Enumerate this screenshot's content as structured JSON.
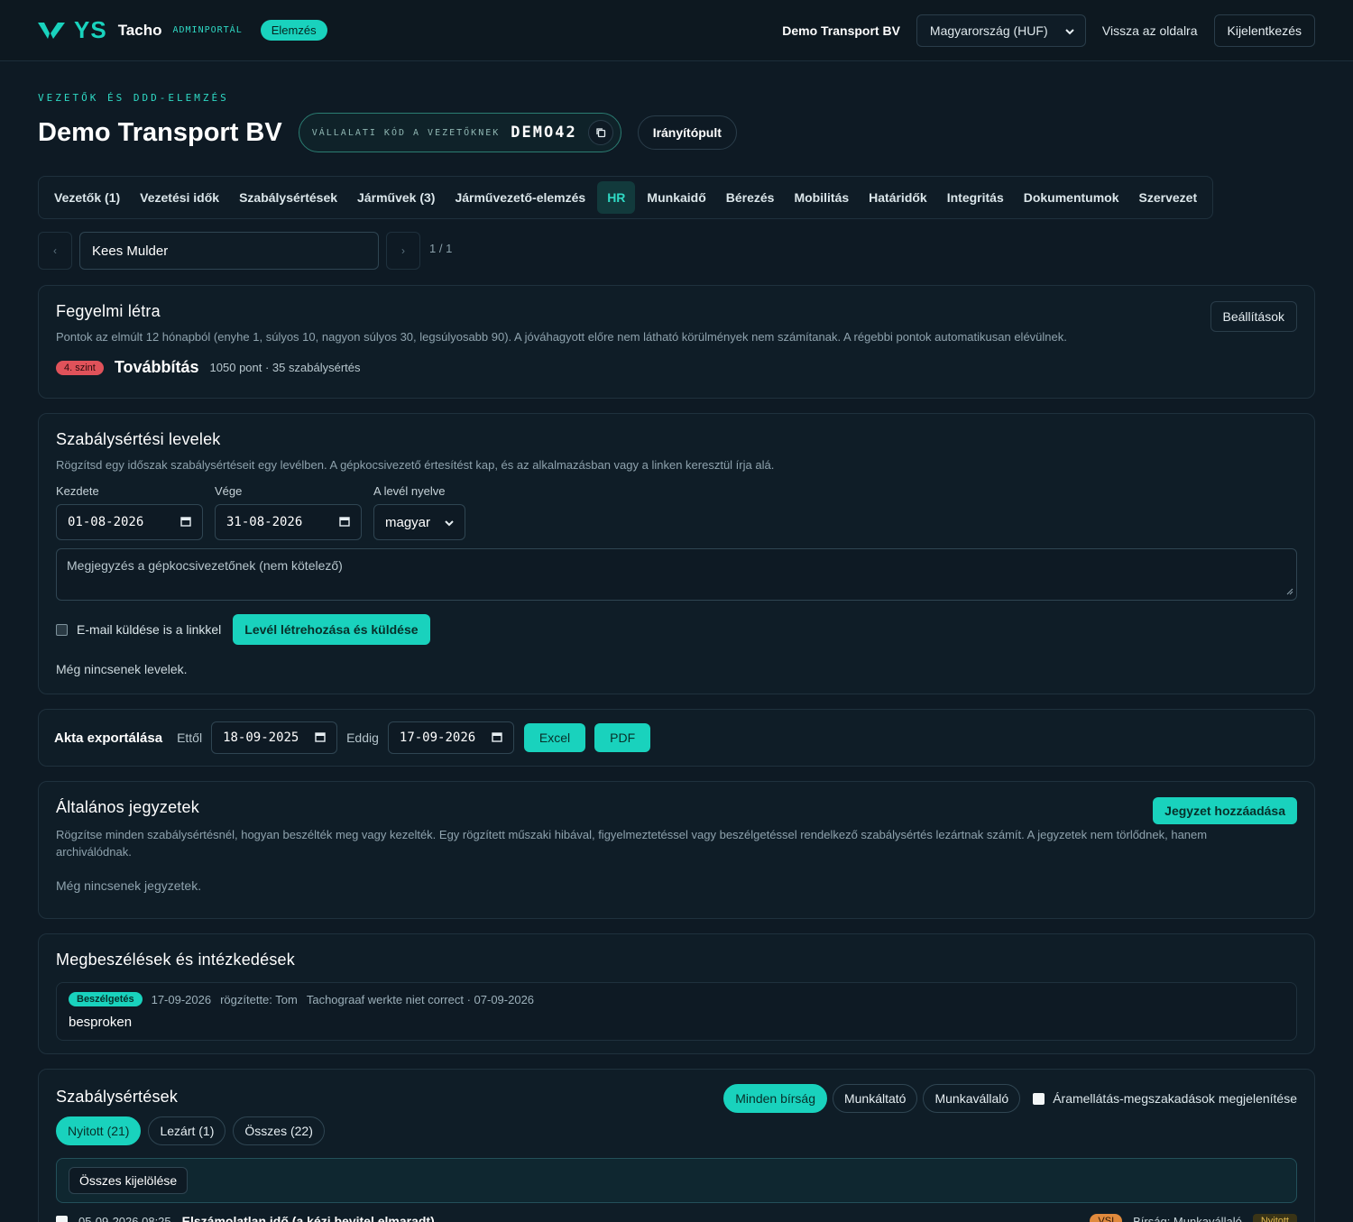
{
  "header": {
    "logo_text": "YS",
    "brand": "Tacho",
    "portal": "ADMINPORTÁL",
    "mode_badge": "Elemzés",
    "company": "Demo Transport BV",
    "country_select": "Magyarország (HUF)",
    "back_link": "Vissza az oldalra",
    "logout": "Kijelentkezés"
  },
  "page": {
    "eyebrow": "VEZETŐK ÉS DDD-ELEMZÉS",
    "title": "Demo Transport BV",
    "code_label": "VÁLLALATI KÓD A VEZETŐKNEK",
    "code_value": "DEMO42",
    "dashboard_button": "Irányítópult"
  },
  "tabs": [
    {
      "label": "Vezetők (1)"
    },
    {
      "label": "Vezetési idők"
    },
    {
      "label": "Szabálysértések"
    },
    {
      "label": "Járművek (3)"
    },
    {
      "label": "Járművezető-elemzés"
    },
    {
      "label": "HR"
    },
    {
      "label": "Munkaidő"
    },
    {
      "label": "Bérezés"
    },
    {
      "label": "Mobilitás"
    },
    {
      "label": "Határidők"
    },
    {
      "label": "Integritás"
    },
    {
      "label": "Dokumentumok"
    },
    {
      "label": "Szervezet"
    }
  ],
  "driver": {
    "prev": "‹",
    "next": "›",
    "name": "Kees Mulder",
    "pager": "1 / 1"
  },
  "ladder": {
    "title": "Fegyelmi létra",
    "settings_button": "Beállítások",
    "description": "Pontok az elmúlt 12 hónapból (enyhe 1, súlyos 10, nagyon súlyos 30, legsúlyosabb 90). A jóváhagyott előre nem látható körülmények nem számítanak. A régebbi pontok automatikusan elévülnek.",
    "level_badge": "4. szint",
    "level_name": "Továbbítás",
    "level_meta": "1050 pont · 35 szabálysértés"
  },
  "letters": {
    "title": "Szabálysértési levelek",
    "description": "Rögzítsd egy időszak szabálysértéseit egy levélben. A gépkocsivezető értesítést kap, és az alkalmazásban vagy a linken keresztül írja alá.",
    "start_label": "Kezdete",
    "start_value": "01-08-2026",
    "end_label": "Vége",
    "end_value": "31-08-2026",
    "lang_label": "A levél nyelve",
    "lang_value": "magyar",
    "note_placeholder": "Megjegyzés a gépkocsivezetőnek (nem kötelező)",
    "email_checkbox": "E-mail küldése is a linkkel",
    "create_button": "Levél létrehozása és küldése",
    "empty": "Még nincsenek levelek."
  },
  "export": {
    "title": "Akta exportálása",
    "from_label": "Ettől",
    "from_value": "18-09-2025",
    "to_label": "Eddig",
    "to_value": "17-09-2026",
    "excel": "Excel",
    "pdf": "PDF"
  },
  "notes": {
    "title": "Általános jegyzetek",
    "add_button": "Jegyzet hozzáadása",
    "description": "Rögzítse minden szabálysértésnél, hogyan beszélték meg vagy kezelték. Egy rögzített műszaki hibával, figyelmeztetéssel vagy beszélgetéssel rendelkező szabálysértés lezártnak számít. A jegyzetek nem törlődnek, hanem archiválódnak.",
    "empty": "Még nincsenek jegyzetek."
  },
  "meetings": {
    "title": "Megbeszélések és intézkedések",
    "item": {
      "badge": "Beszélgetés",
      "date": "17-09-2026",
      "recorded_by": "rögzítette: Tom",
      "ref": "Tachograaf werkte niet correct · 07-09-2026",
      "body": "besproken"
    }
  },
  "violations": {
    "title": "Szabálysértések",
    "filters": [
      "Minden bírság",
      "Munkáltató",
      "Munkavállaló"
    ],
    "power_toggle": "Áramellátás-megszakadások megjelenítése",
    "status_tabs": [
      "Nyitott (21)",
      "Lezárt (1)",
      "Összes (22)"
    ],
    "select_all": "Összes kijelölése",
    "first_row": {
      "datetime": "05-09-2026 08:25",
      "name": "Elszámolatlan idő (a kézi bevitel elmaradt)",
      "severity": "VSI",
      "fine": "Bírság: Munkavállaló",
      "status": "Nyitott"
    }
  },
  "colors": {
    "accent": "#19d2bd",
    "background": "#0e1a24",
    "danger": "#e0525a"
  }
}
